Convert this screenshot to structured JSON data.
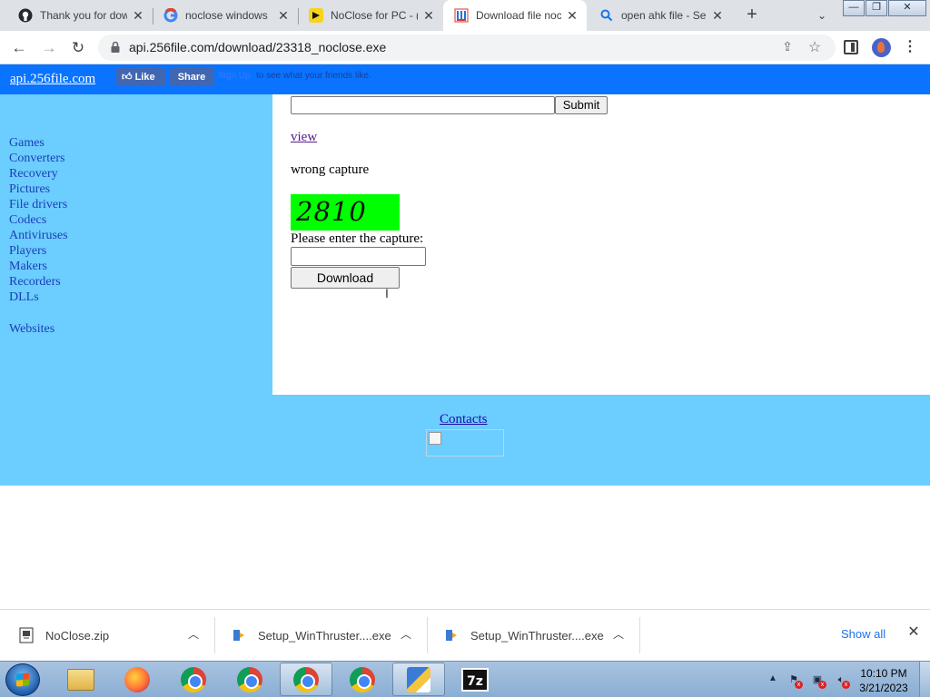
{
  "browser": {
    "tabs": [
      {
        "title": "Thank you for dow",
        "icon": "github-icon"
      },
      {
        "title": "noclose windows",
        "icon": "google-icon"
      },
      {
        "title": "NoClose for PC - (",
        "icon": "noclose-app-icon"
      },
      {
        "title": "Download file noc",
        "icon": "download-site-icon"
      },
      {
        "title": "open ahk file - Se",
        "icon": "search-icon"
      }
    ],
    "active_tab_index": 3,
    "url": "api.256file.com/download/23318_noclose.exe",
    "window_controls": {
      "minimize": "—",
      "restore": "❐",
      "close": "✕"
    }
  },
  "page": {
    "site_link": "api.256file.com",
    "fb_like": "Like",
    "fb_share": "Share",
    "fb_signup": "Sign Up",
    "fb_friends_text": "to see what your friends like.",
    "categories": [
      "Games",
      "Converters",
      "Recovery",
      "Pictures",
      "File drivers",
      "Codecs",
      "Antiviruses",
      "Players",
      "Makers",
      "Recorders",
      "DLLs"
    ],
    "websites_link": "Websites",
    "submit_label": "Submit",
    "view_link": "view",
    "wrong_capture_text": "wrong capture",
    "captcha_code": "2810",
    "enter_capture_label": "Please enter the capture:",
    "download_label": "Download",
    "contacts_link": "Contacts",
    "colors": {
      "topbar": "#0a73ff",
      "sidebar": "#6ccdff",
      "captcha_bg": "#00ff00"
    }
  },
  "downloads": {
    "items": [
      {
        "name": "NoClose.zip",
        "icon": "zip-file-icon"
      },
      {
        "name": "Setup_WinThruster....exe",
        "icon": "installer-icon"
      },
      {
        "name": "Setup_WinThruster....exe",
        "icon": "installer-icon"
      }
    ],
    "show_all": "Show all"
  },
  "taskbar": {
    "apps": [
      "Windows Explorer",
      "Firefox",
      "Chrome",
      "Chrome",
      "Chrome",
      "Chrome",
      "WinThruster Setup",
      "7-Zip"
    ],
    "clock_time": "10:10 PM",
    "clock_date": "3/21/2023"
  }
}
